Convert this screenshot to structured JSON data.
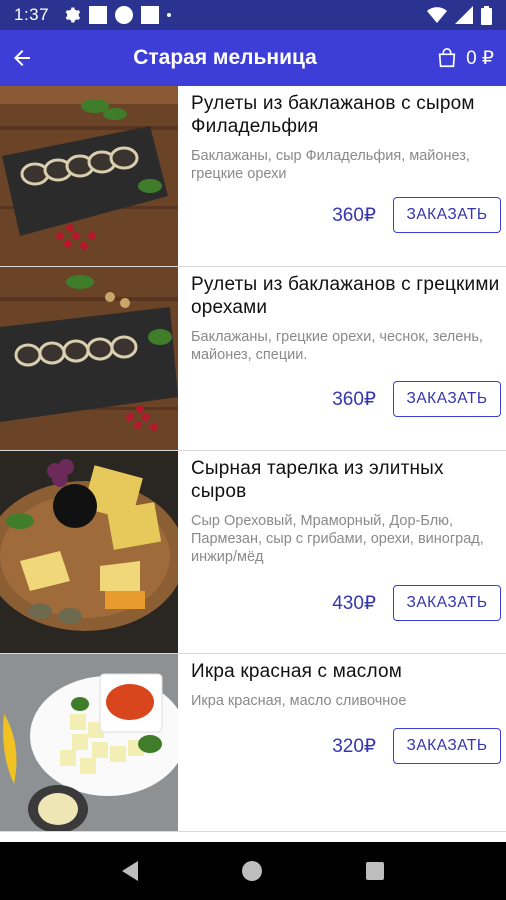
{
  "status_bar": {
    "time": "1:37"
  },
  "app_bar": {
    "title": "Старая мельница",
    "cart_count": "0 ₽"
  },
  "menu": [
    {
      "name": "Рулеты из баклажанов с сыром Филадельфия",
      "description": "Баклажаны, сыр Филадельфия, майонез, грецкие орехи",
      "price": "360₽",
      "button": "ЗАКАЗАТЬ"
    },
    {
      "name": "Рулеты из баклажанов с грецкими орехами",
      "description": "Баклажаны, грецкие орехи, чеснок, зелень, майонез, специи.",
      "price": "360₽",
      "button": "ЗАКАЗАТЬ"
    },
    {
      "name": "Сырная тарелка из элитных сыров",
      "description": "Сыр Ореховый, Мраморный, Дор-Блю, Пармезан, сыр с грибами, орехи, виноград, инжир/мёд",
      "price": "430₽",
      "button": "ЗАКАЗАТЬ"
    },
    {
      "name": "Икра красная с маслом",
      "description": "Икра красная, масло сливочное",
      "price": "320₽",
      "button": "ЗАКАЗАТЬ"
    }
  ],
  "colors": {
    "status_bar": "#2a3490",
    "app_bar": "#3d3ed8",
    "accent": "#3436b0"
  }
}
